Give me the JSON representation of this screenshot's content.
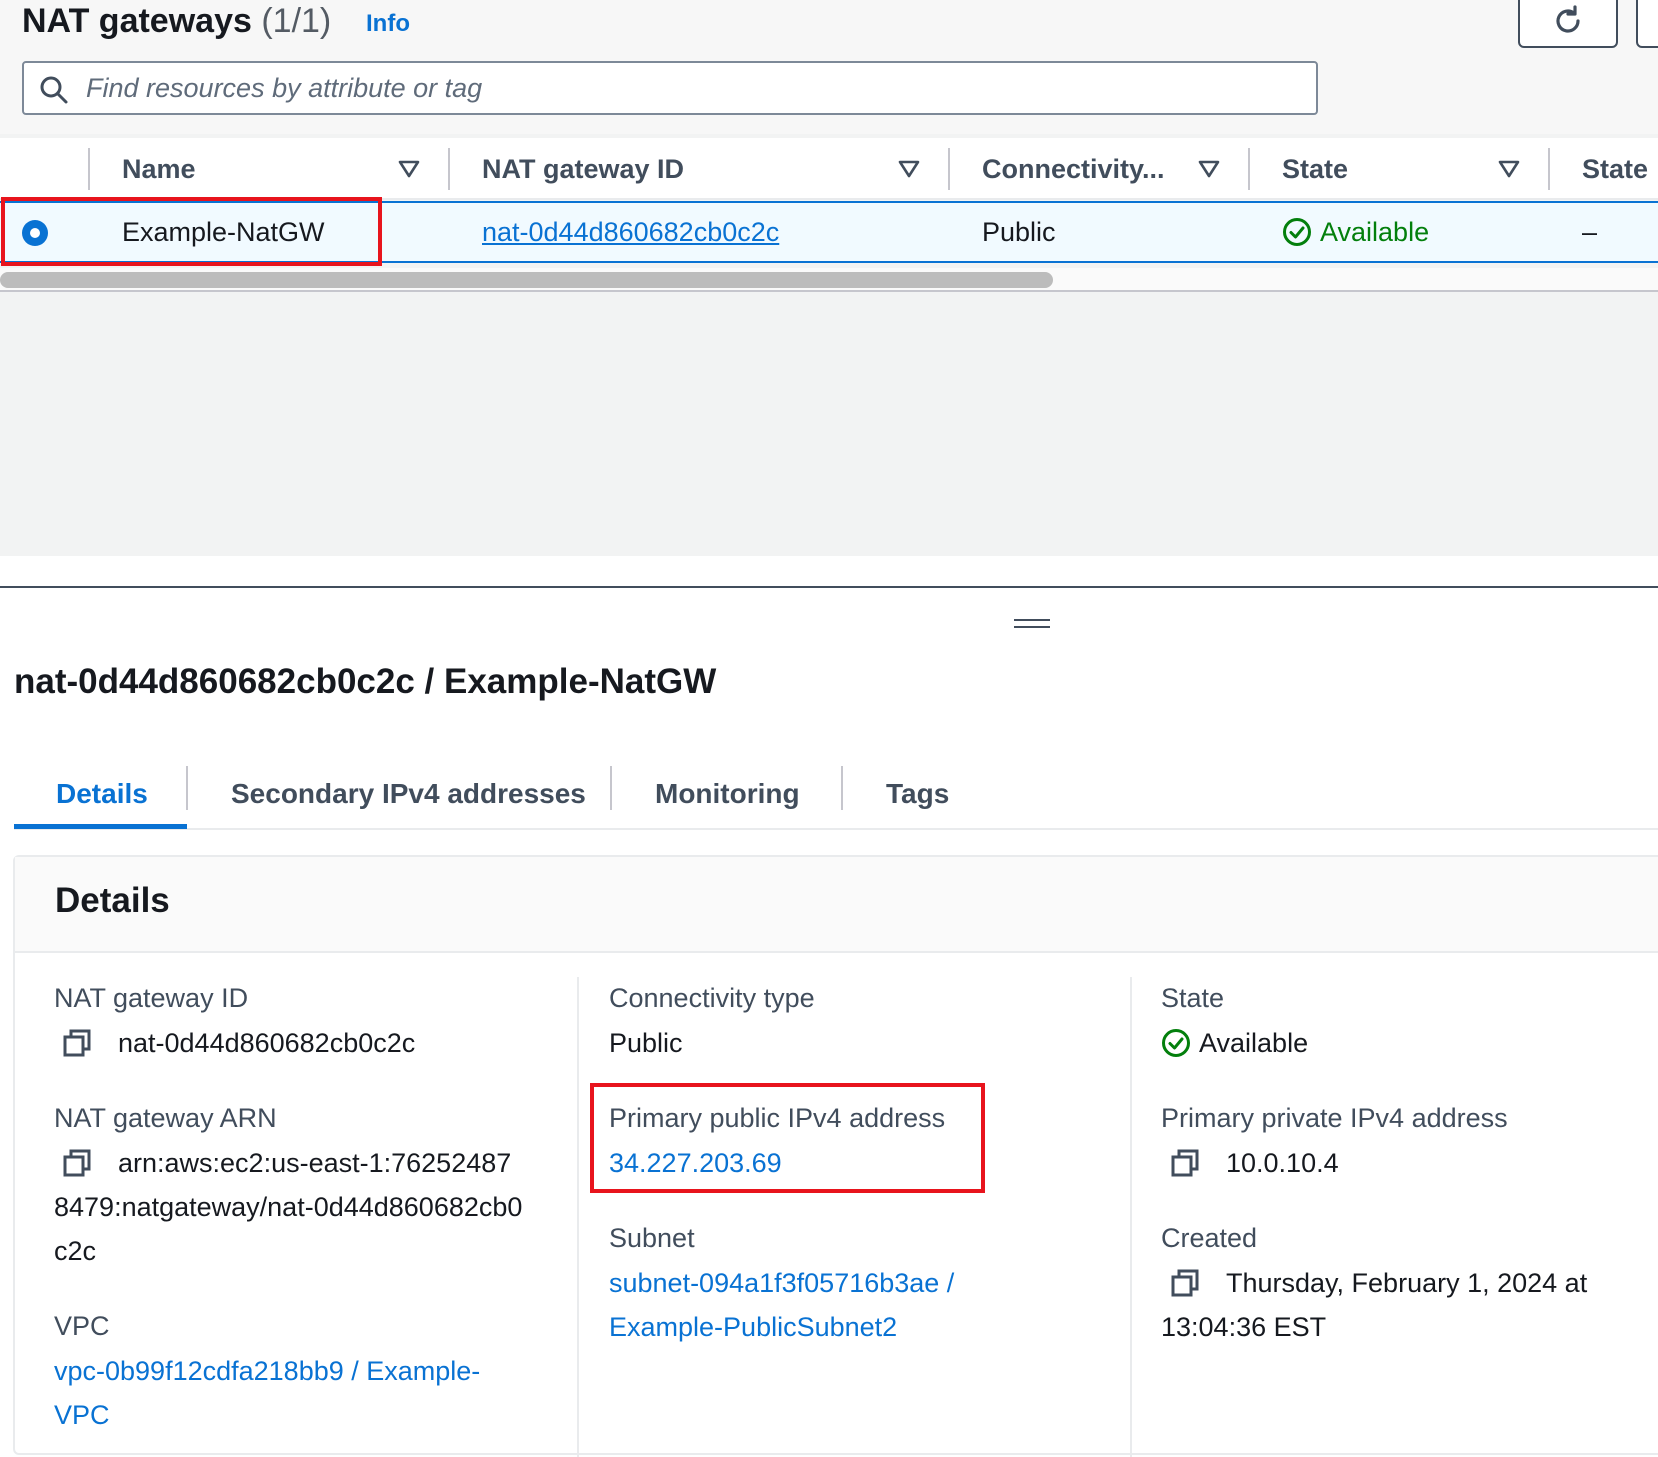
{
  "header": {
    "title": "NAT gateways",
    "count": "(1/1)",
    "info_label": "Info"
  },
  "search": {
    "placeholder": "Find resources by attribute or tag",
    "value": ""
  },
  "table": {
    "columns": [
      "Name",
      "NAT gateway ID",
      "Connectivity...",
      "State",
      "State"
    ],
    "rows": [
      {
        "selected": true,
        "name": "Example-NatGW",
        "nat_gateway_id": "nat-0d44d860682cb0c2c",
        "connectivity": "Public",
        "state": "Available",
        "state_message": "–"
      }
    ]
  },
  "detail": {
    "title": "nat-0d44d860682cb0c2c / Example-NatGW",
    "tabs": [
      "Details",
      "Secondary IPv4 addresses",
      "Monitoring",
      "Tags"
    ],
    "active_tab": "Details",
    "section_heading": "Details",
    "fields": {
      "nat_gateway_id": {
        "label": "NAT gateway ID",
        "value": "nat-0d44d860682cb0c2c"
      },
      "nat_gateway_arn": {
        "label": "NAT gateway ARN",
        "value": "arn:aws:ec2:us-east-1:762524878479:natgateway/nat-0d44d860682cb0c2c"
      },
      "vpc": {
        "label": "VPC",
        "value": "vpc-0b99f12cdfa218bb9 / Example-VPC"
      },
      "connectivity_type": {
        "label": "Connectivity type",
        "value": "Public"
      },
      "primary_public_ipv4": {
        "label": "Primary public IPv4 address",
        "value": "34.227.203.69"
      },
      "subnet": {
        "label": "Subnet",
        "value": "subnet-094a1f3f05716b3ae / Example-PublicSubnet2"
      },
      "state": {
        "label": "State",
        "value": "Available"
      },
      "primary_private_ipv4": {
        "label": "Primary private IPv4 address",
        "value": "10.0.10.4"
      },
      "created": {
        "label": "Created",
        "value": "Thursday, February 1, 2024 at 13:04:36 EST"
      }
    }
  },
  "colors": {
    "link": "#0972d3",
    "success": "#037f0c",
    "highlight_box": "#e8141d",
    "selected_row_bg": "#f1faff"
  },
  "icons": [
    "refresh-icon",
    "search-icon",
    "sort-caret-icon",
    "radio-selected-icon",
    "status-check-icon",
    "copy-icon",
    "drag-handle-icon"
  ]
}
